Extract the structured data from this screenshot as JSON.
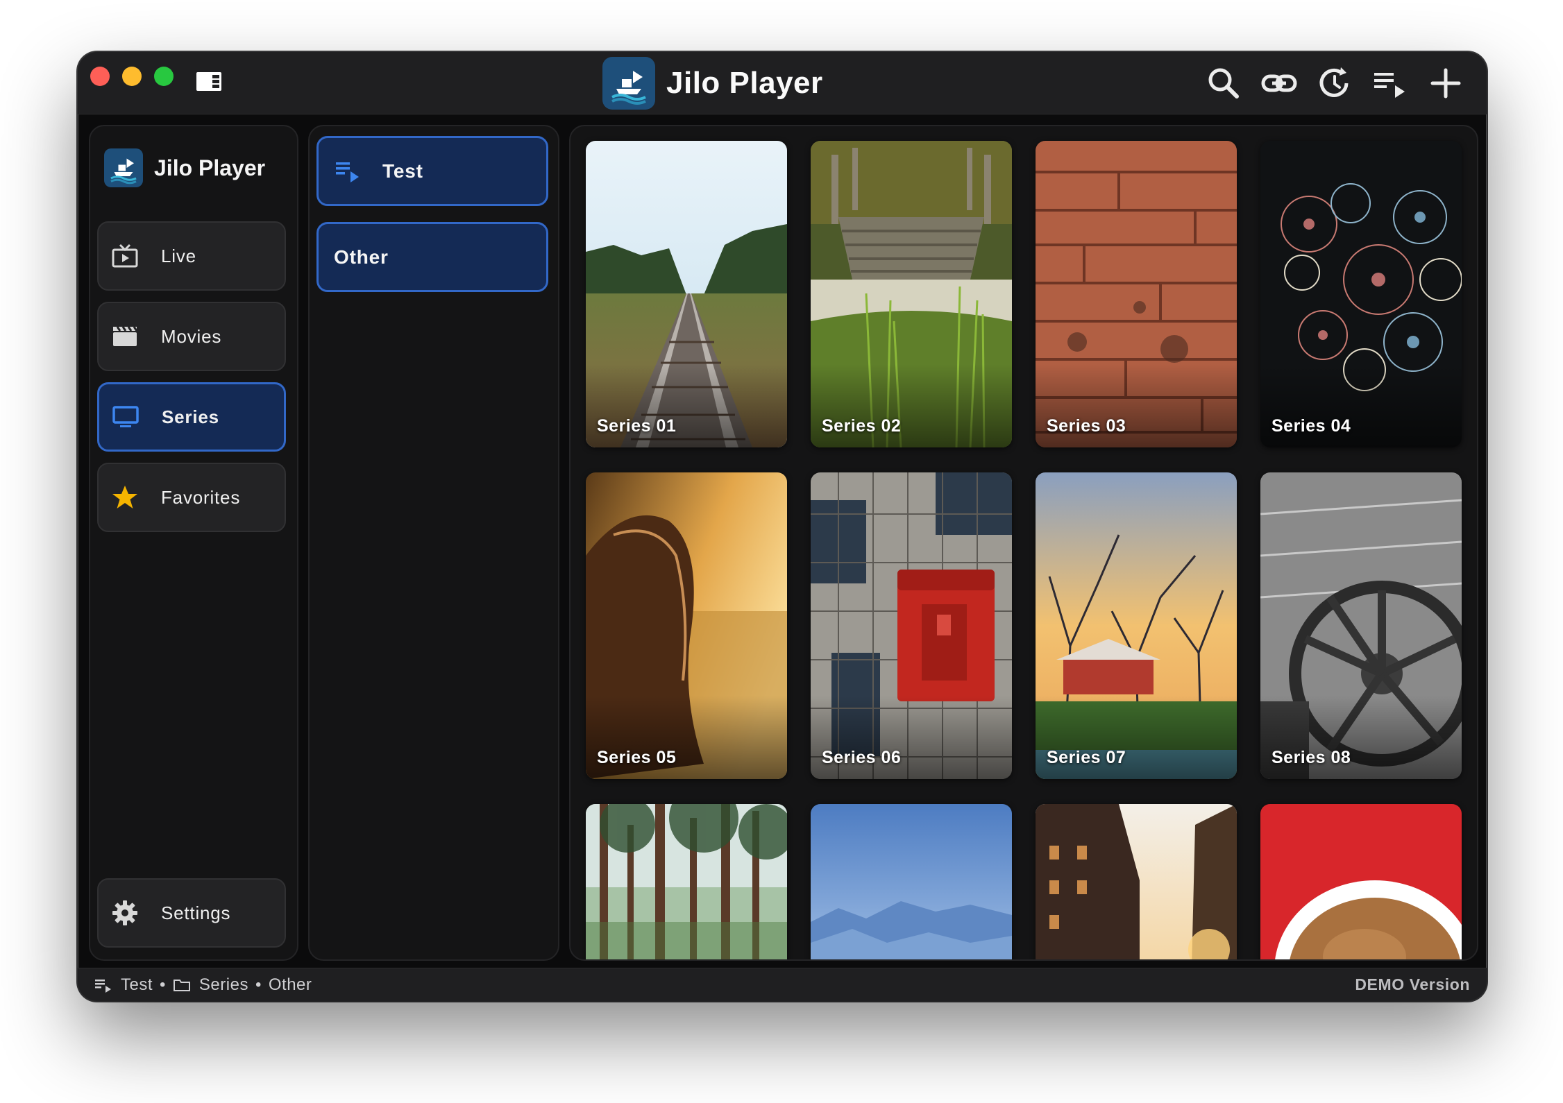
{
  "window": {
    "title": "Jilo Player"
  },
  "toolbar": {
    "icons": [
      "search-icon",
      "link-icon",
      "history-icon",
      "playlist-play-icon",
      "plus-icon"
    ]
  },
  "sidebar": {
    "brand": "Jilo Player",
    "items": [
      {
        "label": "Live",
        "icon": "live-tv-icon"
      },
      {
        "label": "Movies",
        "icon": "clapperboard-icon"
      },
      {
        "label": "Series",
        "icon": "monitor-icon",
        "active": true
      },
      {
        "label": "Favorites",
        "icon": "star-icon"
      }
    ],
    "settings": {
      "label": "Settings",
      "icon": "gear-icon"
    }
  },
  "playlists": [
    {
      "label": "Test",
      "icon": "playlist-play-icon"
    },
    {
      "label": "Other"
    }
  ],
  "grid": {
    "cards": [
      {
        "title": "Series 01",
        "art": "railway-tracks"
      },
      {
        "title": "Series 02",
        "art": "broken-pier"
      },
      {
        "title": "Series 03",
        "art": "wood-planks"
      },
      {
        "title": "Series 04",
        "art": "fireworks"
      },
      {
        "title": "Series 05",
        "art": "girl-sunset"
      },
      {
        "title": "Series 06",
        "art": "red-alarm-box"
      },
      {
        "title": "Series 07",
        "art": "trees-barn"
      },
      {
        "title": "Series 08",
        "art": "wagon-wheel"
      },
      {
        "title": "",
        "art": "pine-forest"
      },
      {
        "title": "",
        "art": "blue-mountains"
      },
      {
        "title": "",
        "art": "city-street"
      },
      {
        "title": "",
        "art": "coffee-cup"
      }
    ]
  },
  "statusbar": {
    "playlist": "Test",
    "section": "Series",
    "category": "Other",
    "separator": "•",
    "edition": "DEMO Version"
  },
  "colors": {
    "accent": "#3268c8",
    "active_bg": "#142a55",
    "star": "#f5b400"
  }
}
